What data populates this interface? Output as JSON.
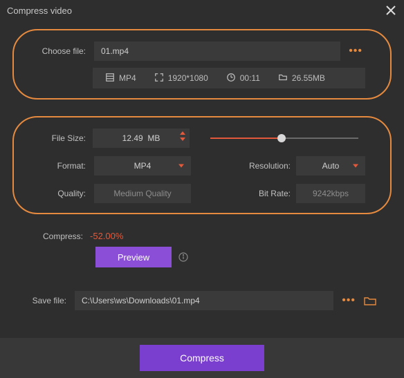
{
  "window": {
    "title": "Compress video"
  },
  "file": {
    "choose_label": "Choose file:",
    "filename": "01.mp4",
    "meta": {
      "format": "MP4",
      "resolution": "1920*1080",
      "duration": "00:11",
      "size": "26.55MB"
    }
  },
  "settings": {
    "file_size_label": "File Size:",
    "file_size_value": "12.49",
    "file_size_unit": "MB",
    "format_label": "Format:",
    "format_value": "MP4",
    "quality_label": "Quality:",
    "quality_value": "Medium Quality",
    "resolution_label": "Resolution:",
    "resolution_value": "Auto",
    "bitrate_label": "Bit Rate:",
    "bitrate_value": "9242kbps",
    "slider_percent": 48
  },
  "compress": {
    "label": "Compress:",
    "value": "-52.00%"
  },
  "preview_label": "Preview",
  "save": {
    "label": "Save file:",
    "path": "C:\\Users\\ws\\Downloads\\01.mp4"
  },
  "action_label": "Compress"
}
